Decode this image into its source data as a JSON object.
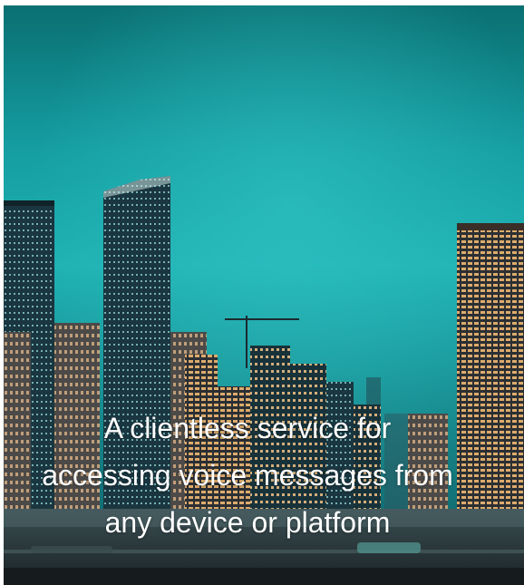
{
  "hero": {
    "headline_lines": [
      "A clientless service for",
      "accessing voice messages from",
      "any device or platform"
    ]
  },
  "colors": {
    "sky_top": "#0a6f72",
    "sky_mid": "#1fb1b3",
    "city_dark": "#10262c",
    "window_light": "#f3c487",
    "text": "#ffffff"
  }
}
